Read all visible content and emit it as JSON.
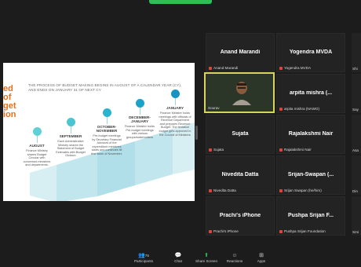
{
  "slide": {
    "edge_text": [
      "ed",
      "of",
      "get",
      "ion"
    ],
    "title": "THE PROCESS OF BUDGET MAKING BEGINS IN AUGUST OF A CALENDAR YEAR (CY), AND ENDS ON JANUARY 31 OF NEXT CY",
    "stages": [
      {
        "month": "AUGUST",
        "desc": "Finance Ministry shares Budget Circular with concerned ministries and departments.",
        "color": "#5fd0d6"
      },
      {
        "month": "SEPTEMBER",
        "desc": "Each Administrative Ministry shares the Statement of Budget Estimates with Budget Division",
        "color": "#4cc5d3"
      },
      {
        "month": "OCTOBER- NOVEMBER",
        "desc": "Pre-budget meetings by Secretary Financial Advisors of the expenditure ministries starts and continues till first week of November.",
        "color": "#2ab3cf"
      },
      {
        "month": "DECEMBER- JANUARY",
        "desc": "Finance Minister holds Pre-budget meetings with various groups/stakeholders",
        "color": "#1aa3c8"
      },
      {
        "month": "JANUARY",
        "desc": "Finance Minister holds meetings with officials of Revenue Department and prepares Revenue Budget. The tentative budget gets approved in the Council of Ministers",
        "color": "#1593c1"
      }
    ]
  },
  "participants": [
    {
      "name": "Anand Marandi",
      "label": "Anand Marandi"
    },
    {
      "name": "Yogendra MVDA",
      "label": "Yogendra MVDA"
    },
    {
      "name": "",
      "label": "Sourav",
      "video": true
    },
    {
      "name": "arpita  mishra (...",
      "label": "arpita mishra (NAWO)"
    },
    {
      "name": "Sujata",
      "label": "Sujata"
    },
    {
      "name": "Rajalakshmi Nair",
      "label": "Rajalakshmi Nair"
    },
    {
      "name": "Nivedita Datta",
      "label": "Nivedita Datta"
    },
    {
      "name": "Srijan-Swapan (...",
      "label": "Srijan Swapan (he/him)"
    },
    {
      "name": "Prachi's iPhone",
      "label": "Prachi's iPhone"
    },
    {
      "name": "Pushpa  Srijan F...",
      "label": "Pushpa Srijan Foundation"
    }
  ],
  "edge_labels": [
    "Shi",
    "Say",
    "Asa",
    "Din",
    "Smi"
  ],
  "toolbar": {
    "participants_label": "Participants",
    "participants_count": "75",
    "chat_label": "Chat",
    "share_label": "Share Screen",
    "reactions_label": "Reactions",
    "apps_label": "Apps"
  },
  "colors": {
    "accent_green": "#2fbd58",
    "active_speaker": "#d8d35a",
    "mic_muted": "#e0433a",
    "slide_accent": "#e8701a"
  }
}
